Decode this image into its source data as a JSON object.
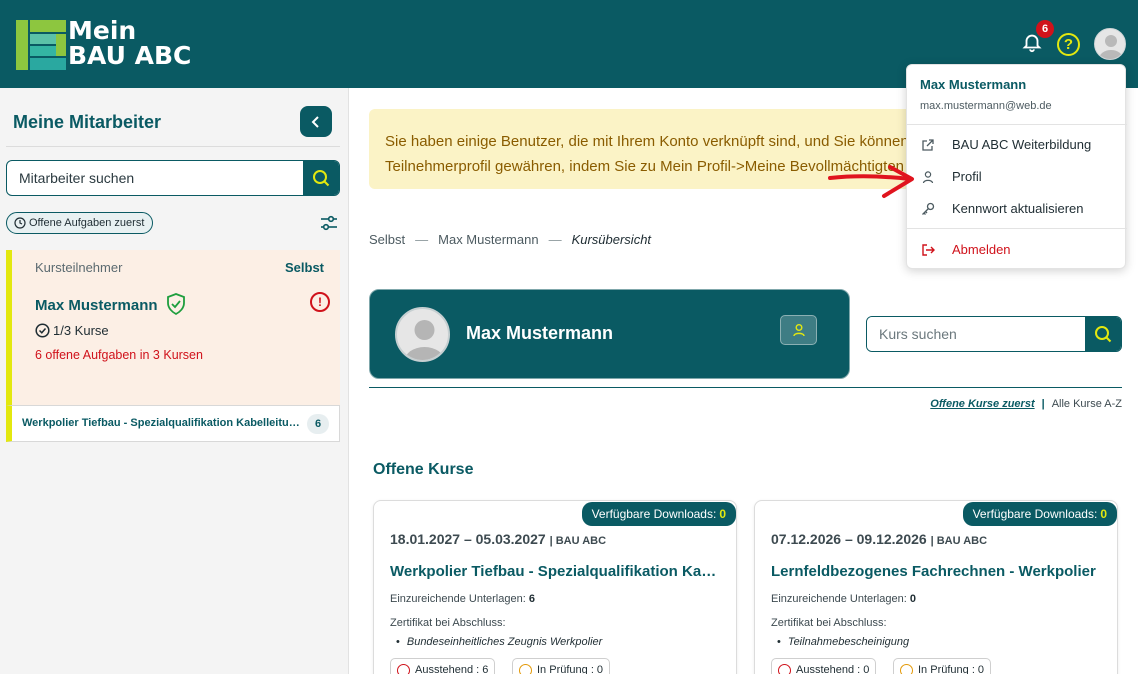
{
  "colors": {
    "brand": "#0a5a63",
    "accent_yellow": "#e3e80f",
    "accent_green": "#8dc63f",
    "alert_red": "#d0121b",
    "notice_bg": "#fbf3c6",
    "notice_text": "#8a5c00",
    "employee_card_bg": "#fcefe5"
  },
  "header": {
    "logo_line1": "Mein",
    "logo_line2": "BAU ABC",
    "notification_count": "6",
    "help_symbol": "?",
    "icons": [
      "bell-icon",
      "help-icon",
      "user-avatar-icon"
    ]
  },
  "sidebar": {
    "title": "Meine Mitarbeiter",
    "search_placeholder": "Mitarbeiter suchen",
    "filter_chip": "Offene Aufgaben zuerst",
    "employee": {
      "role": "Kursteilnehmer",
      "relation": "Selbst",
      "name": "Max Mustermann",
      "courses": "1/3 Kurse",
      "open_tasks": "6 offene Aufgaben in 3 Kursen",
      "alert_symbol": "!",
      "course_row": {
        "title": "Werkpolier Tiefbau - Spezialqualifikation Kabelleitungstiefbau",
        "count": "6"
      }
    }
  },
  "main": {
    "notice_line1": "Sie haben einige Benutzer, die mit Ihrem Konto verknüpft sind, und Sie können",
    "notice_line2": "Teilnehmerprofil gewähren, indem Sie zu Mein Profil->Meine Bevollmächtigten",
    "breadcrumb": {
      "items": [
        "Selbst",
        "Max Mustermann",
        "Kursübersicht"
      ],
      "separator": "—"
    },
    "profile_card": {
      "name": "Max Mustermann"
    },
    "course_search_placeholder": "Kurs suchen",
    "sort": {
      "active": "Offene Kurse zuerst",
      "separator": "|",
      "other": "Alle Kurse A-Z"
    },
    "section_title": "Offene Kurse",
    "courses": [
      {
        "downloads_label": "Verfügbare Downloads:",
        "downloads_count": "0",
        "dates": "18.01.2027 – 05.03.2027",
        "provider": "| BAU ABC",
        "title": "Werkpolier Tiefbau - Spezialqualifikation Kabelleitungstiefbau",
        "docs_label": "Einzureichende Unterlagen:",
        "docs_count": "6",
        "cert_label": "Zertifikat bei Abschluss:",
        "cert_item": "Bundeseinheitliches Zeugnis Werkpolier",
        "pending_label": "Ausstehend : 6",
        "review_label": "In Prüfung : 0"
      },
      {
        "downloads_label": "Verfügbare Downloads:",
        "downloads_count": "0",
        "dates": "07.12.2026 – 09.12.2026",
        "provider": "| BAU ABC",
        "title": "Lernfeldbezogenes Fachrechnen - Werkpolier",
        "docs_label": "Einzureichende Unterlagen:",
        "docs_count": "0",
        "cert_label": "Zertifikat bei Abschluss:",
        "cert_item": "Teilnahmebescheinigung",
        "pending_label": "Ausstehend : 0",
        "review_label": "In Prüfung : 0"
      }
    ]
  },
  "dropdown": {
    "name": "Max Mustermann",
    "email": "max.mustermann@web.de",
    "items": [
      {
        "label": "BAU ABC Weiterbildung",
        "icon": "external-link-icon"
      },
      {
        "label": "Profil",
        "icon": "user-icon"
      },
      {
        "label": "Kennwort aktualisieren",
        "icon": "key-icon"
      },
      {
        "label": "Abmelden",
        "icon": "logout-icon"
      }
    ]
  }
}
